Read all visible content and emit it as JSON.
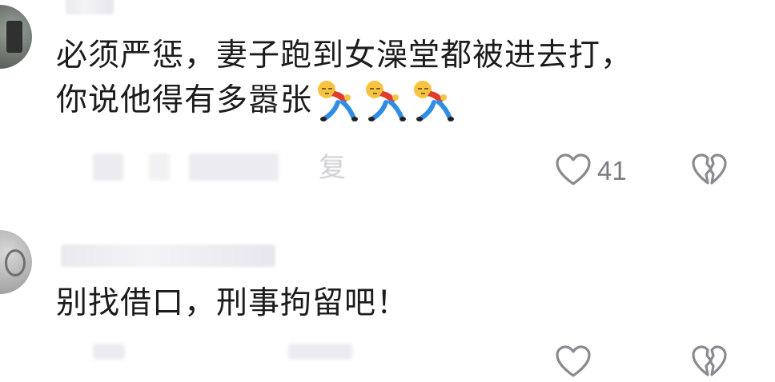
{
  "comments": [
    {
      "text_line1": "必须严惩，妻子跑到女澡堂都被进去打，",
      "text_line2": "你说他得有多嚣张",
      "emoji": [
        "lying-down-emoji",
        "lying-down-emoji",
        "lying-down-emoji"
      ],
      "reply_label": "复",
      "like_count": "41",
      "like_icon": "heart-outline-icon",
      "dislike_icon": "broken-heart-icon"
    },
    {
      "text": "别找借口，刑事拘留吧！",
      "like_icon": "heart-outline-icon",
      "dislike_icon": "broken-heart-icon"
    }
  ],
  "colors": {
    "text": "#1c1c1c",
    "muted": "#7a7a80",
    "icon_stroke": "#8a8a90",
    "background": "#ffffff"
  }
}
